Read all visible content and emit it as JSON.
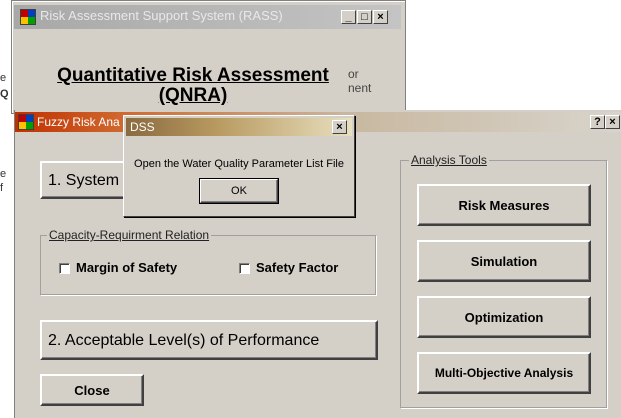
{
  "rass_window": {
    "title": "Risk Assessment Support System (RASS)",
    "heading_line1": "Quantitative Risk Assessment",
    "heading_line2": "(QNRA)",
    "side_text_1": "or",
    "side_text_2": "nent",
    "controls": [
      "_",
      "□",
      "×"
    ]
  },
  "left_fragments": [
    "e",
    "Q",
    "e",
    "f"
  ],
  "fuzzy_window": {
    "title": "Fuzzy Risk Ana",
    "controls": [
      "?",
      "×"
    ],
    "system_button": "1. System",
    "capacity_group": {
      "label": "Capacity-Requirment Relation",
      "checkboxes": [
        {
          "label": "Margin of Safety",
          "checked": false
        },
        {
          "label": "Safety Factor",
          "checked": false
        }
      ]
    },
    "acceptable_button": "2. Acceptable Level(s) of Performance",
    "close_button": "Close",
    "analysis_group": {
      "label": "Analysis Tools",
      "buttons": [
        "Risk Measures",
        "Simulation",
        "Optimization",
        "Multi-Objective Analysis"
      ]
    }
  },
  "dss_dialog": {
    "title": "DSS",
    "close": "×",
    "message": "Open the Water Quality Parameter List File",
    "ok_label": "OK"
  }
}
